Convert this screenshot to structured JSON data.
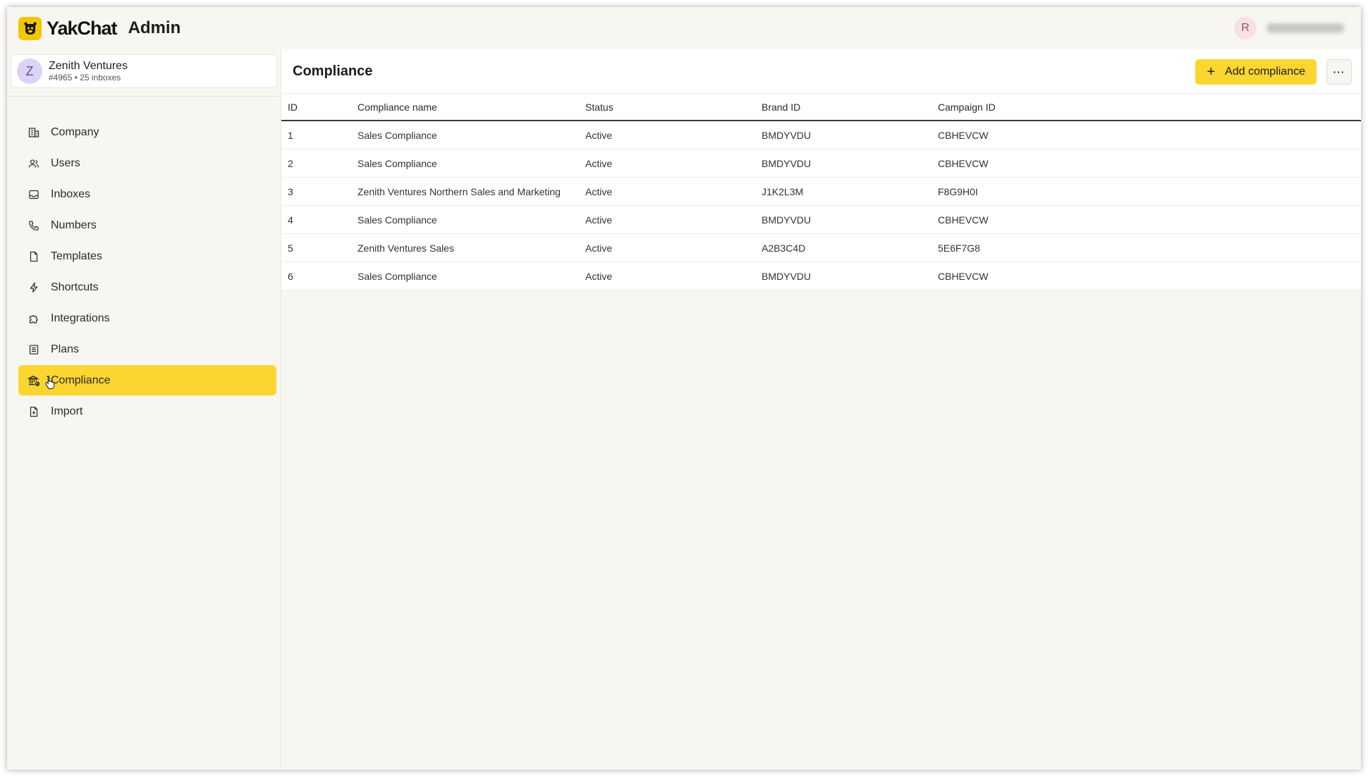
{
  "app": {
    "brand": "YakChat",
    "section": "Admin"
  },
  "user": {
    "initial": "R"
  },
  "account": {
    "initial": "Z",
    "name": "Zenith Ventures",
    "meta": "#4965 • 25 inboxes"
  },
  "nav": [
    {
      "label": "Company",
      "icon": "building-icon"
    },
    {
      "label": "Users",
      "icon": "users-icon"
    },
    {
      "label": "Inboxes",
      "icon": "inbox-icon"
    },
    {
      "label": "Numbers",
      "icon": "phone-icon"
    },
    {
      "label": "Templates",
      "icon": "document-icon"
    },
    {
      "label": "Shortcuts",
      "icon": "lightning-icon"
    },
    {
      "label": "Integrations",
      "icon": "puzzle-icon"
    },
    {
      "label": "Plans",
      "icon": "list-icon"
    },
    {
      "label": "Compliance",
      "icon": "bank-icon",
      "active": true
    },
    {
      "label": "Import",
      "icon": "file-import-icon"
    }
  ],
  "page": {
    "title": "Compliance",
    "add_label": "Add compliance",
    "more_label": "···"
  },
  "table": {
    "columns": [
      "ID",
      "Compliance name",
      "Status",
      "Brand ID",
      "Campaign ID"
    ],
    "rows": [
      [
        "1",
        "Sales Compliance",
        "Active",
        "BMDYVDU",
        "CBHEVCW"
      ],
      [
        "2",
        "Sales Compliance",
        "Active",
        "BMDYVDU",
        "CBHEVCW"
      ],
      [
        "3",
        "Zenith Ventures Northern Sales and Marketing",
        "Active",
        "J1K2L3M",
        "F8G9H0I"
      ],
      [
        "4",
        "Sales Compliance",
        "Active",
        "BMDYVDU",
        "CBHEVCW"
      ],
      [
        "5",
        "Zenith Ventures Sales",
        "Active",
        "A2B3C4D",
        "5E6F7G8"
      ],
      [
        "6",
        "Sales Compliance",
        "Active",
        "BMDYVDU",
        "CBHEVCW"
      ]
    ]
  },
  "colors": {
    "accent": "#fbd631",
    "logo": "#f5c400",
    "background": "#f7f6f1"
  }
}
